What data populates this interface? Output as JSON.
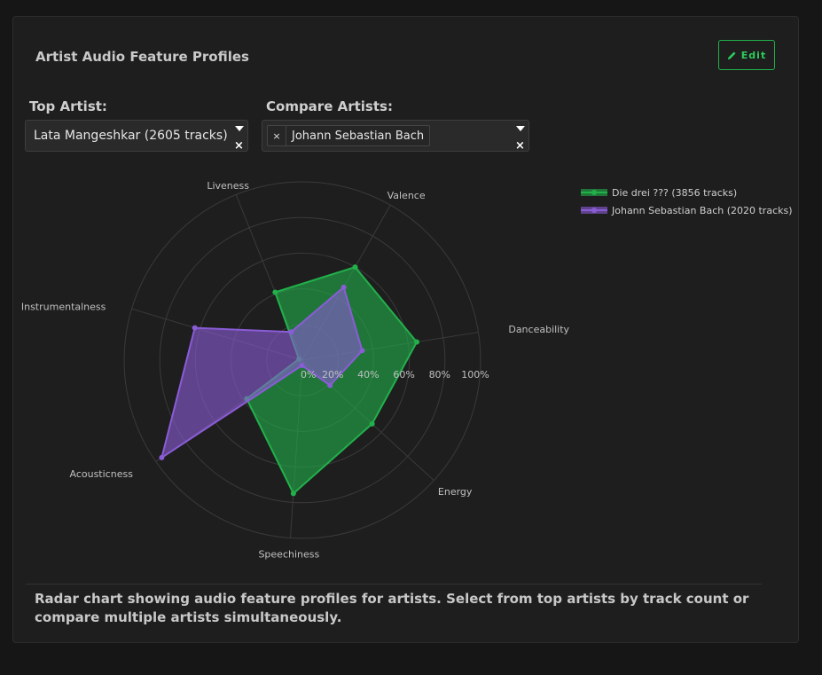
{
  "panel": {
    "title": "Artist Audio Feature Profiles",
    "edit_label": "Edit"
  },
  "top_artist": {
    "label": "Top Artist:",
    "value": "Lata Mangeshkar (2605 tracks)"
  },
  "compare_artists": {
    "label": "Compare Artists:",
    "chips": [
      "Johann Sebastian Bach"
    ]
  },
  "footer": {
    "text": "Radar chart showing audio feature profiles for artists. Select from top artists by track count or compare multiple artists simultaneously."
  },
  "colors": {
    "series_1": "#22b04b",
    "series_2": "#8a5cd6",
    "grid": "#3a3a3a"
  },
  "chart_data": {
    "type": "radar",
    "axes": [
      "Danceability",
      "Energy",
      "Speechiness",
      "Acousticness",
      "Instrumentalness",
      "Liveness",
      "Valence"
    ],
    "radial_range": [
      0,
      100
    ],
    "radial_ticks": [
      "0%",
      "20%",
      "40%",
      "60%",
      "80%",
      "100%"
    ],
    "grid": true,
    "legend_position": "top-right",
    "series": [
      {
        "name": "Die drei ??? (3856 tracks)",
        "values": [
          65,
          53,
          75,
          38,
          2,
          41,
          60
        ]
      },
      {
        "name": "Johann Sebastian Bach (2020 tracks)",
        "values": [
          34,
          21,
          3,
          96,
          63,
          17,
          47
        ]
      }
    ]
  }
}
